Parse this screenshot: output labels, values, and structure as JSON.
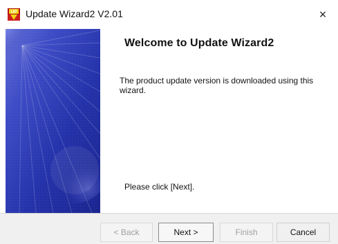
{
  "window": {
    "title": "Update Wizard2 V2.01",
    "close_glyph": "×"
  },
  "icons": {
    "app": "update-wizard-app-icon",
    "close": "close-icon"
  },
  "content": {
    "heading": "Welcome to  Update Wizard2",
    "description": "The product update version is downloaded using this wizard.",
    "hint": "Please click [Next]."
  },
  "buttons": {
    "back": "< Back",
    "next": "Next >",
    "finish": "Finish",
    "cancel": "Cancel"
  },
  "colors": {
    "window_background": "#f0f0f0",
    "content_background": "#ffffff",
    "banner_primary": "#2334a8",
    "banner_secondary": "#6c76d8",
    "text": "#111111",
    "disabled_text": "#a0a0a0"
  }
}
